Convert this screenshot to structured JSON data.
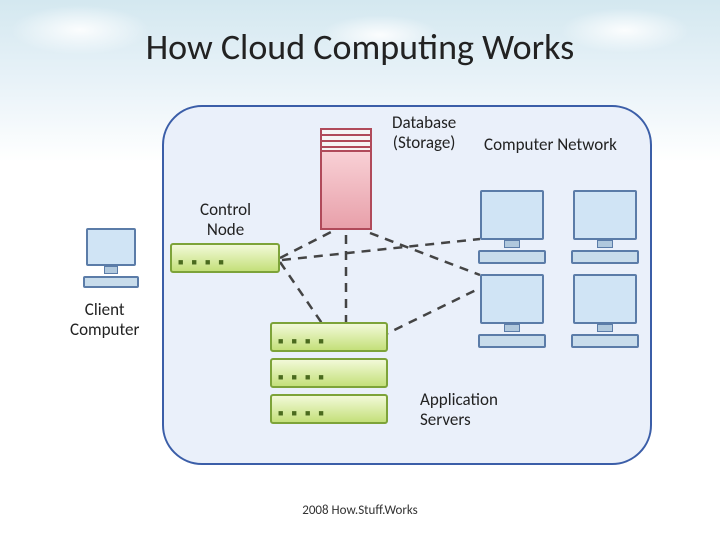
{
  "title": "How Cloud Computing Works",
  "labels": {
    "database": "Database",
    "storage": "(Storage)",
    "computer_network": "Computer Network",
    "control_node": "Control",
    "control_node2": "Node",
    "client_computer": "Client",
    "client_computer2": "Computer",
    "application_servers": "Application",
    "application_servers2": "Servers"
  },
  "attribution": "2008 How.Stuff.Works"
}
